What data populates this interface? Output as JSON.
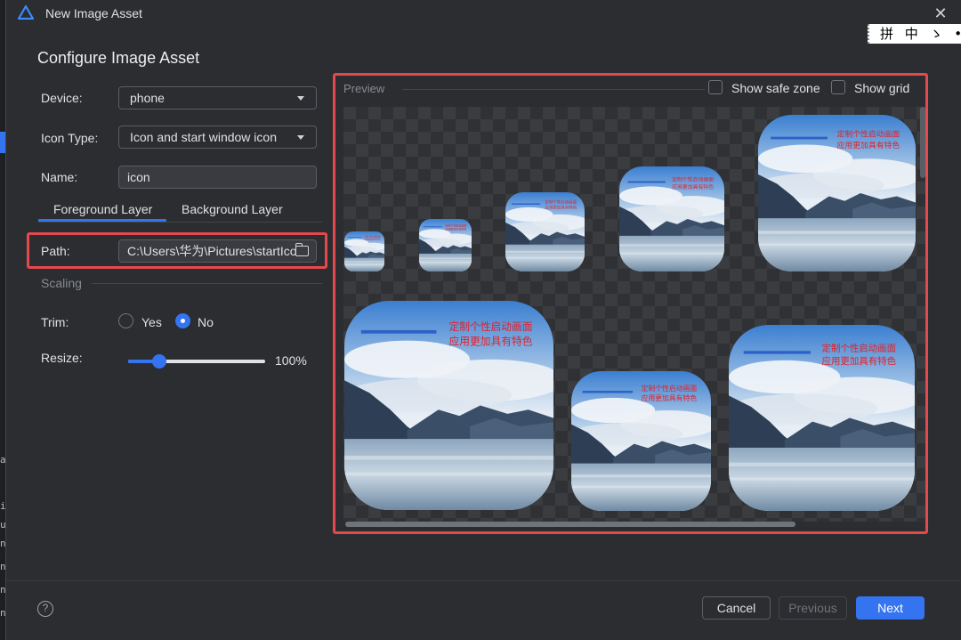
{
  "window": {
    "title": "New Image Asset",
    "close_symbol": "✕"
  },
  "ime": {
    "text": "拼 中 ゝ •,⚙"
  },
  "ide": {
    "code_lines": [
      "a",
      "i",
      "u",
      "n",
      "n",
      "n",
      "n",
      "m"
    ]
  },
  "section_title": "Configure Image Asset",
  "form": {
    "device": {
      "label": "Device:",
      "value": "phone"
    },
    "icon_type": {
      "label": "Icon Type:",
      "value": "Icon and start window icon"
    },
    "name": {
      "label": "Name:",
      "value": "icon"
    },
    "tabs": [
      {
        "label": "Foreground Layer",
        "selected": true
      },
      {
        "label": "Background Layer",
        "selected": false
      }
    ],
    "path": {
      "label": "Path:",
      "value": "C:\\Users\\华为\\Pictures\\startIco"
    },
    "scaling_label": "Scaling",
    "trim": {
      "label": "Trim:",
      "options": [
        "Yes",
        "No"
      ],
      "selected": "No"
    },
    "resize": {
      "label": "Resize:",
      "value": 100,
      "display": "100%",
      "slider_fraction": 0.2
    }
  },
  "preview": {
    "label": "Preview",
    "show_safe_zone": {
      "label": "Show safe zone",
      "checked": false
    },
    "show_grid": {
      "label": "Show grid",
      "checked": false
    },
    "overlay_text": {
      "line1": "定制个性启动画面",
      "line2": "应用更加具有特色"
    }
  },
  "footer": {
    "help_symbol": "?",
    "buttons": {
      "cancel": "Cancel",
      "previous": "Previous",
      "next": "Next"
    }
  },
  "colors": {
    "accent": "#3574f0",
    "highlight": "#e5484d",
    "background": "#2b2d30"
  }
}
